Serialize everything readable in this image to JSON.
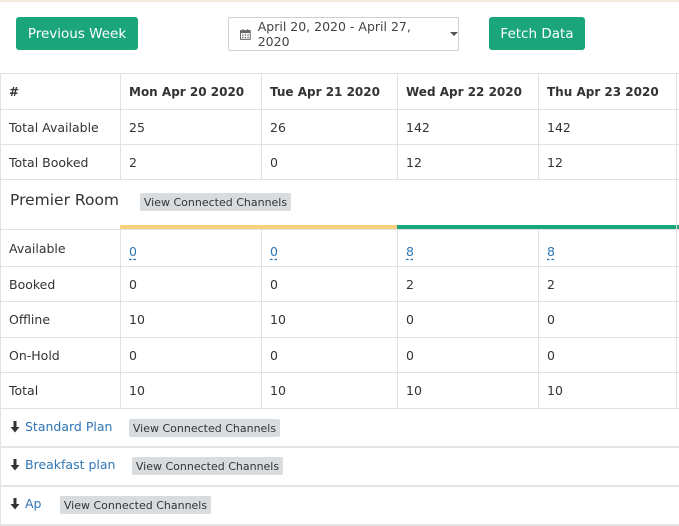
{
  "toolbar": {
    "prev_label": "Previous Week",
    "date_range": "April 20, 2020 - April 27, 2020",
    "fetch_label": "Fetch Data"
  },
  "table": {
    "headers": [
      "#",
      "Mon Apr 20 2020",
      "Tue Apr 21 2020",
      "Wed Apr 22 2020",
      "Thu Apr 23 2020"
    ],
    "summary_rows": [
      {
        "label": "Total Available",
        "values": [
          "25",
          "26",
          "142",
          "142"
        ]
      },
      {
        "label": "Total Booked",
        "values": [
          "2",
          "0",
          "12",
          "12"
        ]
      }
    ]
  },
  "room": {
    "name": "Premier Room",
    "channels_label": "View Connected Channels",
    "availability_colors": [
      "#f5d27f",
      "#f5d27f",
      "#1aa57a",
      "#1aa57a"
    ],
    "rows": [
      {
        "label": "Available",
        "values": [
          "0",
          "0",
          "8",
          "8"
        ]
      },
      {
        "label": "Booked",
        "values": [
          "0",
          "0",
          "2",
          "2"
        ]
      },
      {
        "label": "Offline",
        "values": [
          "10",
          "10",
          "0",
          "0"
        ]
      },
      {
        "label": "On-Hold",
        "values": [
          "0",
          "0",
          "0",
          "0"
        ]
      },
      {
        "label": "Total",
        "values": [
          "10",
          "10",
          "10",
          "10"
        ]
      }
    ]
  },
  "plans": [
    {
      "label": "Standard Plan",
      "channels_label": "View Connected Channels"
    },
    {
      "label": "Breakfast plan",
      "channels_label": "View Connected Channels"
    },
    {
      "label": "Ap",
      "channels_label": "View Connected Channels"
    }
  ]
}
